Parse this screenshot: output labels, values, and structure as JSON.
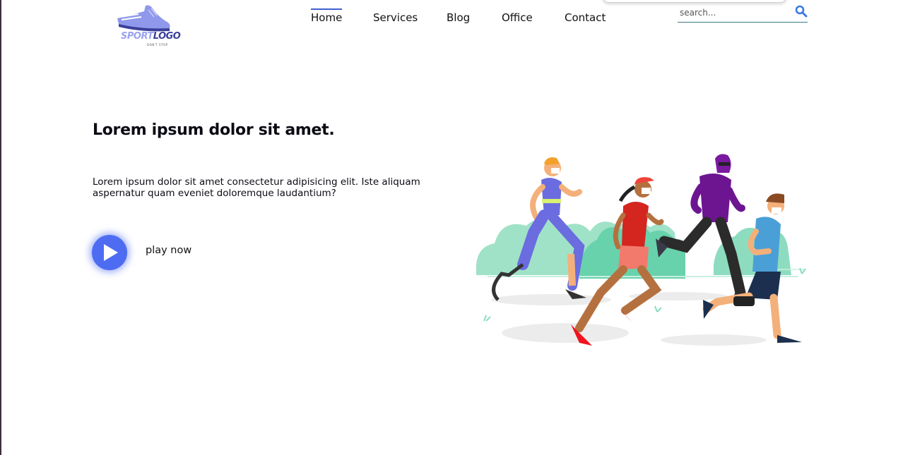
{
  "logo": {
    "text_a": "SPORT",
    "text_b": "LOGO",
    "tagline": "DON'T STOP"
  },
  "nav": {
    "items": [
      {
        "label": "Home",
        "active": true
      },
      {
        "label": "Services",
        "active": false
      },
      {
        "label": "Blog",
        "active": false
      },
      {
        "label": "Office",
        "active": false
      },
      {
        "label": "Contact",
        "active": false
      }
    ]
  },
  "search": {
    "placeholder": "search...",
    "icon": "search-icon"
  },
  "hero": {
    "title": "Lorem ipsum dolor sit amet.",
    "description": "Lorem ipsum dolor sit amet consectetur adipisicing elit. Iste aliquam aspernatur quam eveniet doloremque laudantium?",
    "play_label": "play now",
    "play_icon": "play-icon"
  },
  "colors": {
    "accent": "#4e6cf2",
    "nav_active": "#4060d0",
    "search_icon": "#3b7be0"
  }
}
